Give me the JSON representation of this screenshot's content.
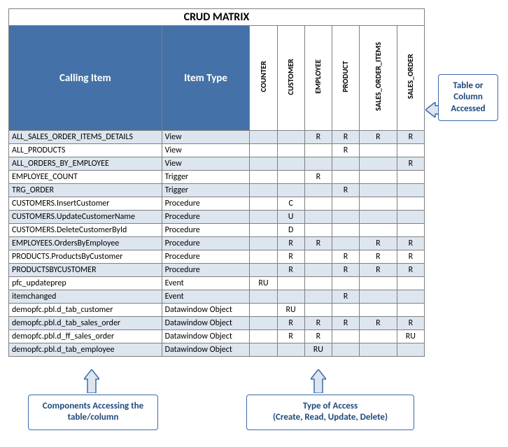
{
  "title": "CRUD MATRIX",
  "headers": {
    "calling_item": "Calling Item",
    "item_type": "Item Type",
    "columns": [
      "COUNTER",
      "CUSTOMER",
      "EMPLOYEE",
      "PRODUCT",
      "SALES_ORDER_ITEMS",
      "SALES_ORDER"
    ]
  },
  "rows": [
    {
      "name": "ALL_SALES_ORDER_ITEMS_DETAILS",
      "type": "View",
      "vals": [
        "",
        "",
        "R",
        "R",
        "R",
        "R"
      ]
    },
    {
      "name": "ALL_PRODUCTS",
      "type": "View",
      "vals": [
        "",
        "",
        "",
        "R",
        "",
        ""
      ]
    },
    {
      "name": "ALL_ORDERS_BY_EMPLOYEE",
      "type": "View",
      "vals": [
        "",
        "",
        "",
        "",
        "",
        "R"
      ]
    },
    {
      "name": "EMPLOYEE_COUNT",
      "type": "Trigger",
      "vals": [
        "",
        "",
        "R",
        "",
        "",
        ""
      ]
    },
    {
      "name": "TRG_ORDER",
      "type": "Trigger",
      "vals": [
        "",
        "",
        "",
        "R",
        "",
        ""
      ]
    },
    {
      "name": "CUSTOMERS.InsertCustomer",
      "type": "Procedure",
      "vals": [
        "",
        "C",
        "",
        "",
        "",
        ""
      ]
    },
    {
      "name": "CUSTOMERS.UpdateCustomerName",
      "type": "Procedure",
      "vals": [
        "",
        "U",
        "",
        "",
        "",
        ""
      ]
    },
    {
      "name": "CUSTOMERS.DeleteCustomerById",
      "type": "Procedure",
      "vals": [
        "",
        "D",
        "",
        "",
        "",
        ""
      ]
    },
    {
      "name": "EMPLOYEES.OrdersByEmployee",
      "type": "Procedure",
      "vals": [
        "",
        "R",
        "R",
        "",
        "R",
        "R"
      ]
    },
    {
      "name": "PRODUCTS.ProductsByCustomer",
      "type": "Procedure",
      "vals": [
        "",
        "R",
        "",
        "R",
        "R",
        "R"
      ]
    },
    {
      "name": "PRODUCTSBYCUSTOMER",
      "type": "Procedure",
      "vals": [
        "",
        "R",
        "",
        "R",
        "R",
        "R"
      ]
    },
    {
      "name": "pfc_updateprep",
      "type": "Event",
      "vals": [
        "RU",
        "",
        "",
        "",
        "",
        ""
      ]
    },
    {
      "name": "itemchanged",
      "type": "Event",
      "vals": [
        "",
        "",
        "",
        "R",
        "",
        ""
      ]
    },
    {
      "name": "demopfc.pbl.d_tab_customer",
      "type": "Datawindow Object",
      "vals": [
        "",
        "RU",
        "",
        "",
        "",
        ""
      ]
    },
    {
      "name": "demopfc.pbl.d_tab_sales_order",
      "type": "Datawindow Object",
      "vals": [
        "",
        "R",
        "R",
        "R",
        "R",
        "R"
      ]
    },
    {
      "name": "demopfc.pbl.d_ff_sales_order",
      "type": "Datawindow Object",
      "vals": [
        "",
        "R",
        "R",
        "",
        "",
        "RU"
      ]
    },
    {
      "name": "demopfc.pbl.d_tab_employee",
      "type": "Datawindow Object",
      "vals": [
        "",
        "",
        "RU",
        "",
        "",
        ""
      ]
    }
  ],
  "callouts": {
    "right": "Table or Column Accessed",
    "bottom_left": "Components Accessing the table/column",
    "bottom_center": "Type of Access\n(Create, Read, Update, Delete)"
  }
}
